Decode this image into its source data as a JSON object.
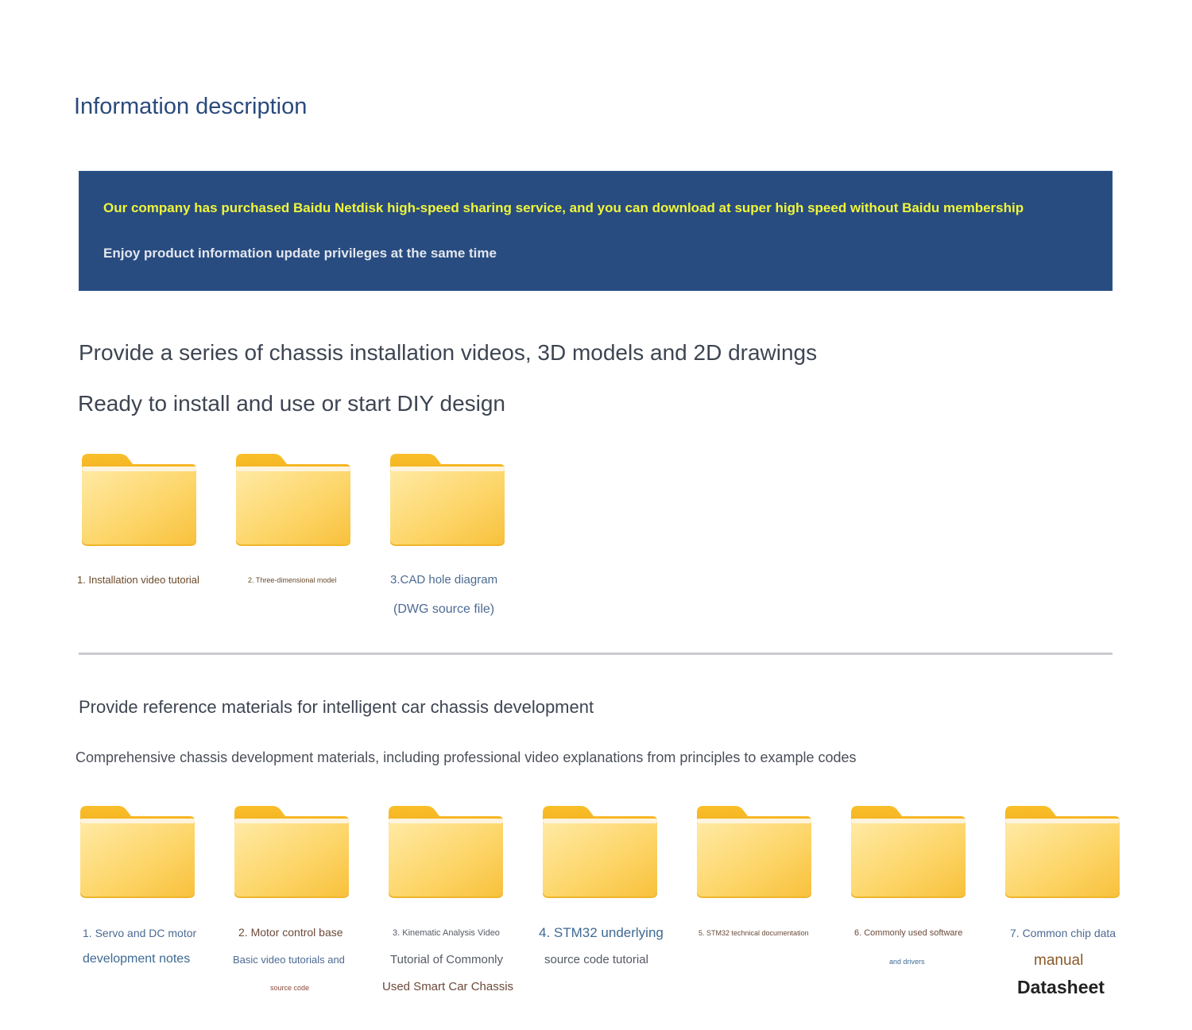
{
  "page_title": "Information description",
  "banner": {
    "line1": "Our company has purchased Baidu Netdisk high-speed sharing service, and you can download at super high speed without Baidu membership",
    "line2": "Enjoy product information update privileges at the same time"
  },
  "section1": {
    "heading1": "Provide a series of chassis installation videos, 3D models and 2D drawings",
    "heading2": "Ready to install and use or start DIY design",
    "folders": [
      {
        "lines": [
          "1. Installation video tutorial"
        ]
      },
      {
        "lines": [
          "2. Three-dimensional model"
        ]
      },
      {
        "lines": [
          "3.CAD hole diagram",
          "(DWG source file)"
        ]
      }
    ]
  },
  "section2": {
    "heading1": "Provide reference materials for intelligent car chassis development",
    "heading2": "Comprehensive chassis development materials, including professional video explanations from principles to example codes",
    "folders": [
      {
        "lines": [
          "1. Servo and DC motor",
          "development notes"
        ]
      },
      {
        "lines": [
          "2. Motor control base",
          "Basic video tutorials and",
          "source code"
        ]
      },
      {
        "lines": [
          "3. Kinematic Analysis Video",
          "Tutorial of Commonly",
          "Used Smart Car Chassis"
        ]
      },
      {
        "lines": [
          "4. STM32 underlying",
          "source code tutorial"
        ]
      },
      {
        "lines": [
          "5. STM32 technical documentation"
        ]
      },
      {
        "lines": [
          "6. Commonly used software",
          "and drivers"
        ]
      },
      {
        "lines": [
          "7. Common chip data",
          "manual",
          "Datasheet"
        ]
      }
    ]
  },
  "colors": {
    "banner_bg": "#284c80",
    "banner_highlight": "#f0f53a",
    "folder_yellow": "#fcd15a",
    "folder_tab": "#f7b925"
  },
  "icons": {
    "folder": "folder-icon"
  }
}
